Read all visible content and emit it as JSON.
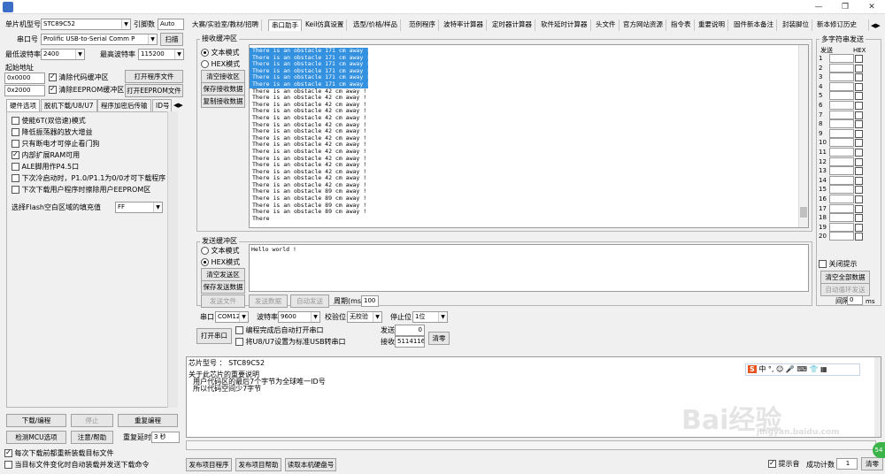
{
  "window": {
    "title": "",
    "min": "—",
    "max": "❐",
    "close": "✕"
  },
  "left": {
    "mcu_label": "单片机型号",
    "mcu_value": "STC89C52",
    "pins_label": "引脚数",
    "pins_value": "Auto",
    "port_label": "串口号",
    "port_value": "Prolific USB-to-Serial Comm P",
    "scan": "扫描",
    "minbaud_label": "最低波特率",
    "minbaud_value": "2400",
    "maxbaud_label": "最高波特率",
    "maxbaud_value": "115200",
    "start_addr": "起始地址",
    "addr1": "0x0000",
    "clear_code": "清除代码缓冲区",
    "open_prog": "打开程序文件",
    "addr2": "0x2000",
    "clear_eeprom": "清除EEPROM缓冲区",
    "open_eeprom": "打开EEPROM文件",
    "tabs": [
      "硬件选项",
      "脱机下载/U8/U7",
      "程序加密后传输",
      "ID号"
    ],
    "options": [
      {
        "label": "使能6T(双倍速)模式",
        "checked": false
      },
      {
        "label": "降低振荡器的放大增益",
        "checked": false
      },
      {
        "label": "只有断电才可停止看门狗",
        "checked": false
      },
      {
        "label": "内部扩展RAM可用",
        "checked": true
      },
      {
        "label": "ALE脚用作P4.5口",
        "checked": false
      },
      {
        "label": "下次冷启动时，P1.0/P1.1为0/0才可下载程序",
        "checked": false
      },
      {
        "label": "下次下载用户程序时擦除用户EEPROM区",
        "checked": false
      }
    ],
    "fill_label": "选择Flash空白区域的填充值",
    "fill_value": "FF",
    "download": "下载/编程",
    "stop": "停止",
    "reprogram": "重复编程",
    "detect": "检测MCU选项",
    "help": "注意/帮助",
    "delay_label": "重复延时",
    "delay_value": "3 秒",
    "reload": "每次下载前都重新装载目标文件",
    "autoload": "当目标文件变化时自动装载并发送下载命令"
  },
  "tabs": [
    "大赛/实验室/教材/招聘",
    "串口助手",
    "Keil仿真设置",
    "选型/价格/样品",
    "范例程序",
    "波特率计算器",
    "定时器计算器",
    "软件延时计算器",
    "头文件",
    "官方网站资源",
    "指令表",
    "重要说明",
    "固件新本备注",
    "封装脚位",
    "新本修订历史"
  ],
  "recv": {
    "title": "接收缓冲区",
    "text_mode": "文本模式",
    "hex_mode": "HEX模式",
    "clear": "清空接收区",
    "save": "保存接收数据",
    "copy": "复制接收数据",
    "lines": [
      {
        "t": "There is an obstacle 171 cm away !",
        "sel": true
      },
      {
        "t": "There is an obstacle 171 cm away !",
        "sel": true
      },
      {
        "t": "There is an obstacle 171 cm away !",
        "sel": true
      },
      {
        "t": "There is an obstacle 171 cm away !",
        "sel": true
      },
      {
        "t": "There is an obstacle 171 cm away !",
        "sel": true
      },
      {
        "t": "There is an obstacle 171 cm away !",
        "sel": true
      },
      {
        "t": "There is an obstacle 42 cm away !",
        "sel": false
      },
      {
        "t": "There is an obstacle 42 cm away !",
        "sel": false
      },
      {
        "t": "There is an obstacle 42 cm away !",
        "sel": false
      },
      {
        "t": "There is an obstacle 42 cm away !",
        "sel": false
      },
      {
        "t": "There is an obstacle 42 cm away !",
        "sel": false
      },
      {
        "t": "There is an obstacle 42 cm away !",
        "sel": false
      },
      {
        "t": "There is an obstacle 42 cm away !",
        "sel": false
      },
      {
        "t": "There is an obstacle 42 cm away !",
        "sel": false
      },
      {
        "t": "There is an obstacle 42 cm away !",
        "sel": false
      },
      {
        "t": "There is an obstacle 42 cm away !",
        "sel": false
      },
      {
        "t": "There is an obstacle 42 cm away !",
        "sel": false
      },
      {
        "t": "There is an obstacle 42 cm away !",
        "sel": false
      },
      {
        "t": "There is an obstacle 42 cm away !",
        "sel": false
      },
      {
        "t": "There is an obstacle 42 cm away !",
        "sel": false
      },
      {
        "t": "There is an obstacle 42 cm away !",
        "sel": false
      },
      {
        "t": "There is an obstacle 89 cm away !",
        "sel": false
      },
      {
        "t": "There is an obstacle 89 cm away !",
        "sel": false
      },
      {
        "t": "There is an obstacle 89 cm away !",
        "sel": false
      },
      {
        "t": "There is an obstacle 89 cm away !",
        "sel": false
      },
      {
        "t": "There",
        "sel": false
      }
    ]
  },
  "send": {
    "title": "发送缓冲区",
    "text_mode": "文本模式",
    "hex_mode": "HEX模式",
    "clear": "清空发送区",
    "save": "保存发送数据",
    "content": "Hello world !",
    "send_file": "发送文件",
    "send_data": "发送数据",
    "auto_send": "自动发送",
    "period_label": "周期(ms)",
    "period_value": "100"
  },
  "serial": {
    "port_label": "串口",
    "port_value": "COM12",
    "baud_label": "波特率",
    "baud_value": "9600",
    "parity_label": "校验位",
    "parity_value": "无校验",
    "stop_label": "停止位",
    "stop_value": "1位",
    "open": "打开串口",
    "auto_open": "编程完成后自动打开串口",
    "set_usb": "将U8/U7设置为标准USB转串口",
    "sent_label": "发送",
    "sent_value": "0",
    "recv_label": "接收",
    "recv_value": "5114116",
    "clear": "清零"
  },
  "multi": {
    "title": "多字符串发送",
    "send_col": "发送",
    "hex_col": "HEX",
    "rows": [
      "1",
      "2",
      "3",
      "4",
      "5",
      "6",
      "7",
      "8",
      "9",
      "10",
      "11",
      "12",
      "13",
      "14",
      "15",
      "16",
      "17",
      "18",
      "19",
      "20"
    ],
    "close_tip": "关闭提示",
    "clear_all": "清空全部数据",
    "auto_loop": "自动循环发送",
    "interval_label": "间隔",
    "interval_value": "0",
    "interval_unit": "ms"
  },
  "info": {
    "chip_label": "芯片型号 ： STC89C52",
    "lines": [
      "关于此芯片的重要说明",
      "  用户代码区的最后7个字节为全球唯一ID号",
      "  所以代码空间少7字节"
    ]
  },
  "bottom": {
    "publish": "发布项目程序",
    "publish_help": "发布项目帮助",
    "read_disk": "读取本机硬盘号",
    "beep": "提示音",
    "count_label": "成功计数",
    "count_value": "1",
    "clear": "清零"
  },
  "watermark": {
    "main": "Bai经验",
    "url": "jingyan.baidu.com"
  }
}
